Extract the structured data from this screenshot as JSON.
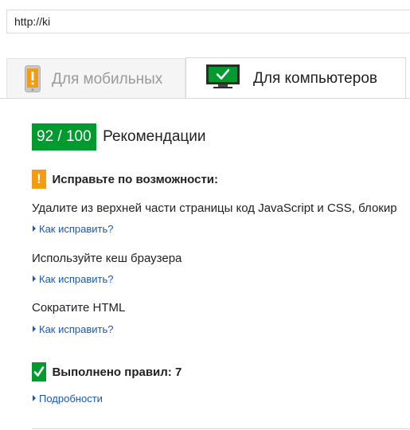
{
  "url_bar": {
    "value": "http://ki"
  },
  "tabs": {
    "mobile": {
      "label": "Для мобильных",
      "icon": "mobile-phone-icon",
      "warning_color": "#f39c12"
    },
    "desktop": {
      "label": "Для компьютеров",
      "icon": "desktop-monitor-icon",
      "active": true
    }
  },
  "score": {
    "value": "92 / 100",
    "label": "Рекомендации",
    "color": "#009a2f"
  },
  "fix_section": {
    "title": "Исправьте по возможности:",
    "badge": "!",
    "badge_color": "#f39c12",
    "rules": [
      {
        "text": "Удалите из верхней части страницы код JavaScript и CSS, блокир",
        "link": "Как исправить?"
      },
      {
        "text": "Используйте кеш браузера",
        "link": "Как исправить?"
      },
      {
        "text": "Сократите HTML",
        "link": "Как исправить?"
      }
    ]
  },
  "passed_section": {
    "title": "Выполнено правил: 7",
    "badge_color": "#009a2f",
    "link": "Подробности"
  },
  "colors": {
    "link": "#1a58b5",
    "accent_green": "#009a2f",
    "warning_orange": "#f39c12"
  }
}
